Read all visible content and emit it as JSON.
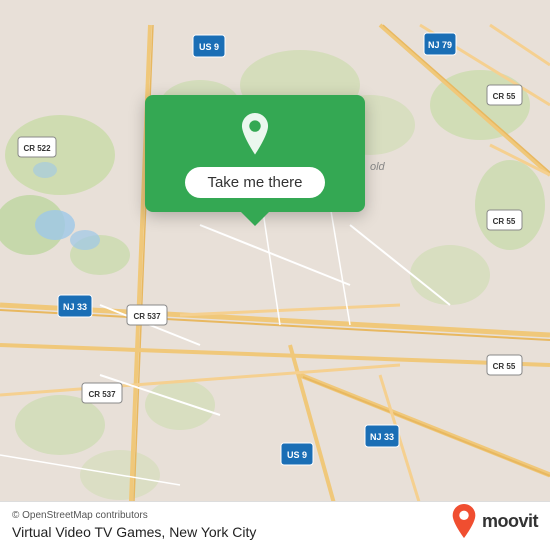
{
  "map": {
    "background_color": "#e4ddd4",
    "attribution": "© OpenStreetMap contributors",
    "location_name": "Virtual Video TV Games, New York City"
  },
  "popup": {
    "button_label": "Take me there",
    "pin_color": "#ffffff"
  },
  "branding": {
    "moovit_label": "moovit"
  },
  "road_labels": {
    "us9": "US 9",
    "nj79": "NJ 79",
    "cr522": "CR 522",
    "cr55_top": "CR 55",
    "cr55_mid": "CR 55",
    "cr537_top": "CR 537",
    "cr537_bot": "CR 537",
    "nj33_left": "NJ 33",
    "nj33_right": "NJ 33",
    "us9_bot": "US 9",
    "cr55_bot": "CR 55"
  }
}
